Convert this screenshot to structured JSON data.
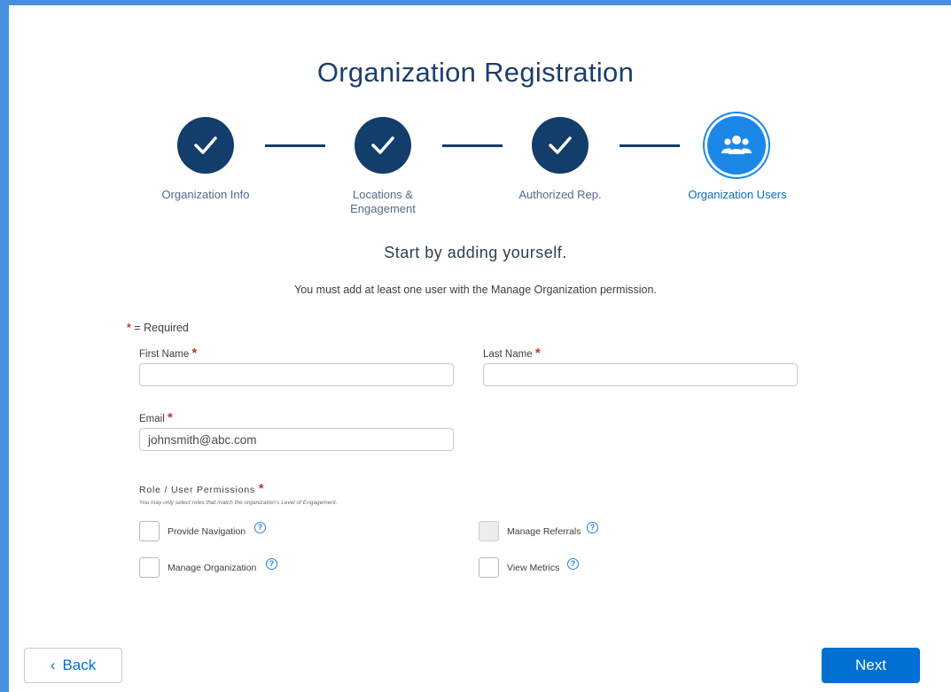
{
  "page_title": "Organization Registration",
  "steps": [
    {
      "label": "Organization Info",
      "state": "complete",
      "icon": "check-icon"
    },
    {
      "label": "Locations & Engagement",
      "state": "complete",
      "icon": "check-icon"
    },
    {
      "label": "Authorized Rep.",
      "state": "complete",
      "icon": "check-icon"
    },
    {
      "label": "Organization Users",
      "state": "active",
      "icon": "users-group-icon"
    }
  ],
  "subtitle": "Start by adding yourself.",
  "info_text": "You must add at least one user with the Manage Organization permission.",
  "required_note": {
    "symbol": "*",
    "text": "= Required"
  },
  "form": {
    "first_name": {
      "label": "First Name",
      "value": "",
      "placeholder": ""
    },
    "last_name": {
      "label": "Last Name",
      "value": "",
      "placeholder": ""
    },
    "email": {
      "label": "Email",
      "value": "johnsmith@abc.com"
    }
  },
  "permissions": {
    "title": "Role / User Permissions",
    "hint": "You may only select roles that match the organization's Level of Engagement.",
    "options": [
      {
        "label": "Provide Navigation",
        "checked": false,
        "disabled": false
      },
      {
        "label": "Manage Referrals",
        "checked": false,
        "disabled": true
      },
      {
        "label": "Manage Organization",
        "checked": false,
        "disabled": false
      },
      {
        "label": "View Metrics",
        "checked": false,
        "disabled": false
      }
    ]
  },
  "buttons": {
    "back": "Back",
    "back_icon": "‹",
    "next": "Next"
  },
  "colors": {
    "primary": "#0070d2",
    "step_complete": "#133d6a",
    "step_active": "#1b88e8",
    "required": "#d0302e",
    "frame": "#4a90e2"
  }
}
